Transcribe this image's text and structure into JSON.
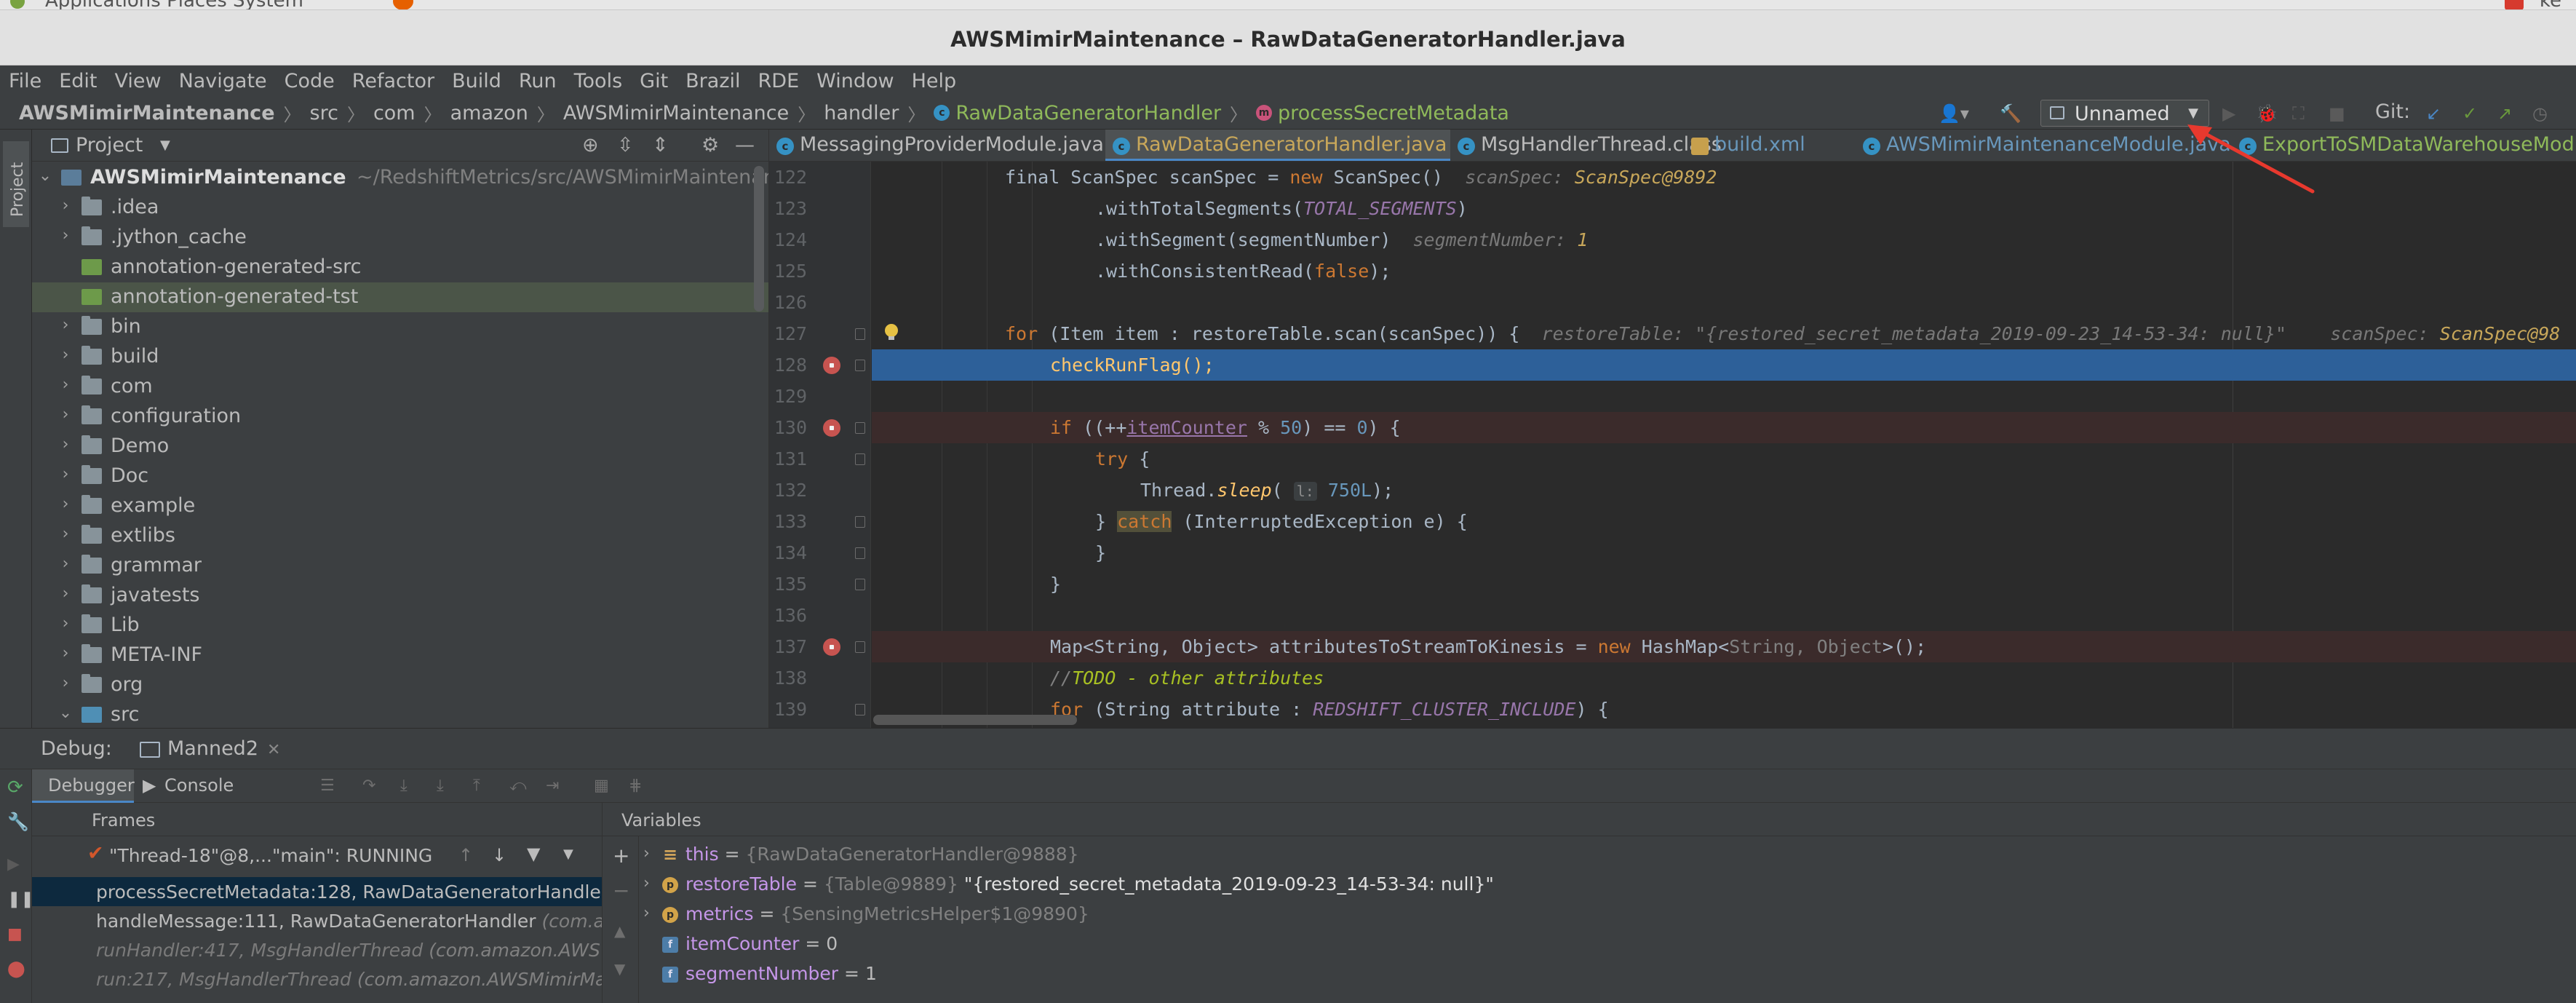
{
  "system_bar": {
    "text": "Applications  Places  System",
    "right_text": "ke"
  },
  "window": {
    "title": "AWSMimirMaintenance – RawDataGeneratorHandler.java"
  },
  "menu": [
    "File",
    "Edit",
    "View",
    "Navigate",
    "Code",
    "Refactor",
    "Build",
    "Run",
    "Tools",
    "Git",
    "Brazil",
    "RDE",
    "Window",
    "Help"
  ],
  "breadcrumb": {
    "project": "AWSMimirMaintenance",
    "path": [
      "src",
      "com",
      "amazon",
      "AWSMimirMaintenance",
      "handler"
    ],
    "class": "RawDataGeneratorHandler",
    "method": "processSecretMetadata"
  },
  "toolbar": {
    "run_config": "Unnamed",
    "git_label": "Git:"
  },
  "project_panel": {
    "title": "Project",
    "items": [
      {
        "label": "AWSMimirMaintenance",
        "path": "~/RedshiftMetrics/src/AWSMimirMaintenance",
        "depth": 0,
        "expanded": true,
        "icon": "module"
      },
      {
        "label": ".idea",
        "depth": 1,
        "expanded": false,
        "icon": "folder"
      },
      {
        "label": ".jython_cache",
        "depth": 1,
        "expanded": false,
        "icon": "folder"
      },
      {
        "label": "annotation-generated-src",
        "depth": 1,
        "expanded": null,
        "icon": "genfolder"
      },
      {
        "label": "annotation-generated-tst",
        "depth": 1,
        "expanded": null,
        "icon": "genfolder",
        "selected": true
      },
      {
        "label": "bin",
        "depth": 1,
        "expanded": false,
        "icon": "folder"
      },
      {
        "label": "build",
        "depth": 1,
        "expanded": false,
        "icon": "folder"
      },
      {
        "label": "com",
        "depth": 1,
        "expanded": false,
        "icon": "folder"
      },
      {
        "label": "configuration",
        "depth": 1,
        "expanded": false,
        "icon": "folder"
      },
      {
        "label": "Demo",
        "depth": 1,
        "expanded": false,
        "icon": "folder"
      },
      {
        "label": "Doc",
        "depth": 1,
        "expanded": false,
        "icon": "folder"
      },
      {
        "label": "example",
        "depth": 1,
        "expanded": false,
        "icon": "folder"
      },
      {
        "label": "extlibs",
        "depth": 1,
        "expanded": false,
        "icon": "folder"
      },
      {
        "label": "grammar",
        "depth": 1,
        "expanded": false,
        "icon": "folder"
      },
      {
        "label": "javatests",
        "depth": 1,
        "expanded": false,
        "icon": "folder"
      },
      {
        "label": "Lib",
        "depth": 1,
        "expanded": false,
        "icon": "folder"
      },
      {
        "label": "META-INF",
        "depth": 1,
        "expanded": false,
        "icon": "folder"
      },
      {
        "label": "org",
        "depth": 1,
        "expanded": false,
        "icon": "folder"
      },
      {
        "label": "src",
        "depth": 1,
        "expanded": true,
        "icon": "srcfolder"
      }
    ]
  },
  "editor_tabs": [
    {
      "label": "MessagingProviderModule.java",
      "style": "normal",
      "icon": "C"
    },
    {
      "label": "RawDataGeneratorHandler.java",
      "style": "orange",
      "icon": "C",
      "active": true
    },
    {
      "label": "MsgHandlerThread.class",
      "style": "normal",
      "icon": "C"
    },
    {
      "label": "build.xml",
      "style": "blue",
      "icon": "X"
    },
    {
      "label": "AWSMimirMaintenanceModule.java",
      "style": "blue",
      "icon": "C"
    },
    {
      "label": "ExportToSMDataWarehouseModule",
      "style": "green",
      "icon": "C"
    }
  ],
  "code": {
    "lines": [
      {
        "n": "122",
        "html_id": "l122"
      },
      {
        "n": "123",
        "html_id": "l123"
      },
      {
        "n": "124",
        "html_id": "l124"
      },
      {
        "n": "125",
        "html_id": "l125"
      },
      {
        "n": "126",
        "html_id": "l126"
      },
      {
        "n": "127",
        "html_id": "l127"
      },
      {
        "n": "128",
        "html_id": "l128"
      },
      {
        "n": "129",
        "html_id": "l129"
      },
      {
        "n": "130",
        "html_id": "l130"
      },
      {
        "n": "131",
        "html_id": "l131"
      },
      {
        "n": "132",
        "html_id": "l132"
      },
      {
        "n": "133",
        "html_id": "l133"
      },
      {
        "n": "134",
        "html_id": "l134"
      },
      {
        "n": "135",
        "html_id": "l135"
      },
      {
        "n": "136",
        "html_id": "l136"
      },
      {
        "n": "137",
        "html_id": "l137"
      },
      {
        "n": "138",
        "html_id": "l138"
      },
      {
        "n": "139",
        "html_id": "l139"
      }
    ],
    "text": {
      "t122a": "final ScanSpec scanSpec = ",
      "t122b": "new",
      "t122c": " ScanSpec()",
      "t122h": "scanSpec: ",
      "t122v": "ScanSpec@9892",
      "t123a": ".withTotalSegments(",
      "t123b": "TOTAL_SEGMENTS",
      "t123c": ")",
      "t124a": ".withSegment(segmentNumber)",
      "t124h": "segmentNumber: ",
      "t124v": "1",
      "t125a": ".withConsistentRead(",
      "t125b": "false",
      "t125c": ");",
      "t127a": "for",
      "t127b": " (Item item : restoreTable.scan(scanSpec)) {",
      "t127h": "restoreTable: \"{restored_secret_metadata_2019-09-23_14-53-34: null}\"",
      "t127h2": "scanSpec: ",
      "t127v2": "ScanSpec@98",
      "t128a": "checkRunFlag();",
      "t130a": "if",
      "t130b": " ((++",
      "t130c": "itemCounter",
      "t130d": " % ",
      "t130e": "50",
      "t130f": ") == ",
      "t130g": "0",
      "t130h": ") {",
      "t131a": "try",
      "t131b": " {",
      "t132a": "Thread.",
      "t132b": "sleep",
      "t132c": "( ",
      "t132p": "l:",
      "t132d": " 750L",
      "t132e": ");",
      "t133a": "} ",
      "t133b": "catch",
      "t133c": " (InterruptedException e) {",
      "t134a": "}",
      "t135a": "}",
      "t137a": "Map<String, Object> attributesToStreamToKinesis = ",
      "t137b": "new",
      "t137c": " HashMap<",
      "t137d": "String, Object",
      "t137e": ">();",
      "t138a": "//",
      "t138b": "TODO - other attributes",
      "t139a": "for",
      "t139b": " (String attribute : ",
      "t139c": "REDSHIFT_CLUSTER_INCLUDE",
      "t139d": ") {"
    }
  },
  "debug": {
    "label": "Debug:",
    "session": "Manned2",
    "tabs": [
      "Debugger",
      "Console"
    ],
    "frames_title": "Frames",
    "variables_title": "Variables",
    "thread": "\"Thread-18\"@8,...\"main\": RUNNING",
    "frames": [
      {
        "name": "processSecretMetadata:128, RawDataGeneratorHandle",
        "pkg": "",
        "selected": true
      },
      {
        "name": "handleMessage:111, RawDataGeneratorHandler ",
        "pkg": "(com.a",
        "dim": false
      },
      {
        "name": "runHandler:417, MsgHandlerThread ",
        "pkg": "(com.amazon.AWS",
        "dim": true
      },
      {
        "name": "run:217, MsgHandlerThread ",
        "pkg": "(com.amazon.AWSMimirMa",
        "dim": true
      }
    ],
    "variables": [
      {
        "icon": "this",
        "name": "this",
        "value": "{RawDataGeneratorHandler@9888}",
        "expandable": true
      },
      {
        "icon": "p",
        "name": "restoreTable",
        "value": "{Table@9889}",
        "str": " \"{restored_secret_metadata_2019-09-23_14-53-34: null}\"",
        "expandable": true
      },
      {
        "icon": "p",
        "name": "metrics",
        "value": "{SensingMetricsHelper$1@9890}",
        "expandable": true
      },
      {
        "icon": "f",
        "name": "itemCounter",
        "value": "0",
        "expandable": false
      },
      {
        "icon": "f",
        "name": "segmentNumber",
        "value": "1",
        "expandable": false
      }
    ]
  },
  "colors": {
    "accent": "#4a88c7",
    "current_line": "#2d6099",
    "breakpoint": "#c75450",
    "annotation_arrow": "#e8392e"
  }
}
